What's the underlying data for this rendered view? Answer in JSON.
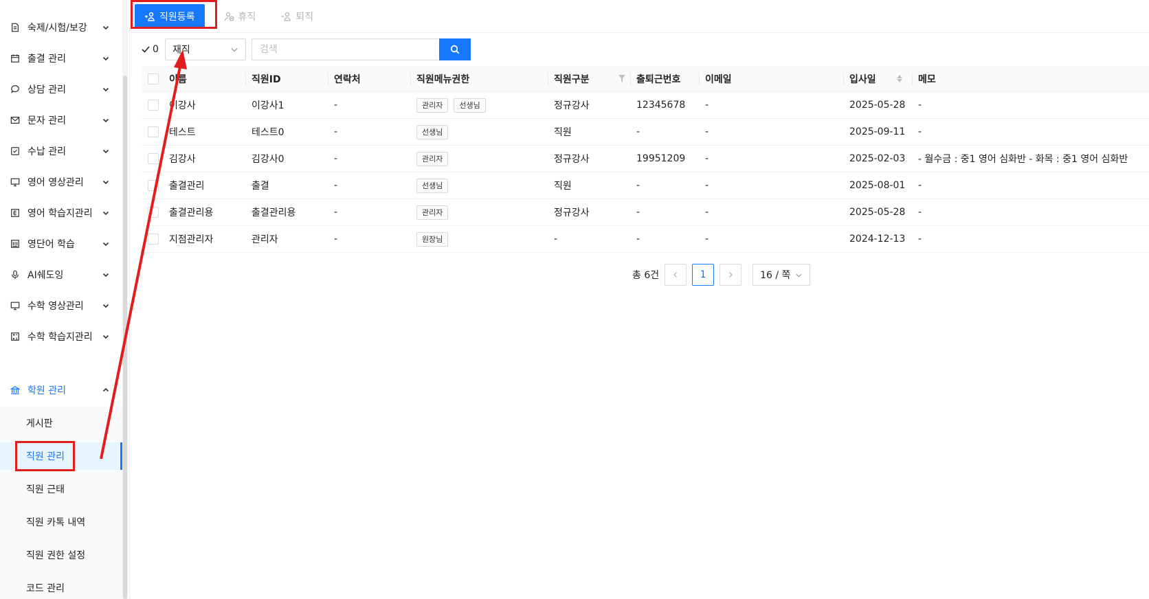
{
  "sidebar": {
    "items": [
      {
        "label": "숙제/시험/보강",
        "icon": "document-icon"
      },
      {
        "label": "출결 관리",
        "icon": "calendar-icon"
      },
      {
        "label": "상담 관리",
        "icon": "chat-icon"
      },
      {
        "label": "문자 관리",
        "icon": "mail-icon"
      },
      {
        "label": "수납 관리",
        "icon": "payment-icon"
      },
      {
        "label": "영어 영상관리",
        "icon": "monitor-icon"
      },
      {
        "label": "영어 학습지관리",
        "icon": "worksheet-icon"
      },
      {
        "label": "영단어 학습",
        "icon": "book-icon"
      },
      {
        "label": "AI쉐도잉",
        "icon": "microphone-icon"
      },
      {
        "label": "수학 영상관리",
        "icon": "monitor-icon"
      },
      {
        "label": "수학 학습지관리",
        "icon": "calculator-icon"
      },
      {
        "label": "학원 관리",
        "icon": "bank-icon"
      }
    ],
    "sub_items": [
      {
        "label": "게시판"
      },
      {
        "label": "직원 관리"
      },
      {
        "label": "직원 근태"
      },
      {
        "label": "직원 카톡 내역"
      },
      {
        "label": "직원 권한 설정"
      },
      {
        "label": "코드 관리"
      }
    ]
  },
  "toolbar": {
    "register_label": "직원등록",
    "leave_label": "휴직",
    "resign_label": "퇴직"
  },
  "filter": {
    "selected_count": "0",
    "status_value": "재직",
    "search_placeholder": "검색"
  },
  "table": {
    "headers": {
      "name": "이름",
      "staff_id": "직원ID",
      "contact": "연락처",
      "menu_permission": "직원메뉴권한",
      "staff_type": "직원구분",
      "attendance_no": "출퇴근번호",
      "email": "이메일",
      "join_date": "입사일",
      "memo": "메모"
    },
    "rows": [
      {
        "name": "이강사",
        "staff_id": "이강사1",
        "contact": "-",
        "tags": [
          "관리자",
          "선생님"
        ],
        "staff_type": "정규강사",
        "attendance_no": "12345678",
        "email": "-",
        "join_date": "2025-05-28",
        "memo": "-"
      },
      {
        "name": "테스트",
        "staff_id": "테스트0",
        "contact": "-",
        "tags": [
          "선생님"
        ],
        "staff_type": "직원",
        "attendance_no": "-",
        "email": "-",
        "join_date": "2025-09-11",
        "memo": "-"
      },
      {
        "name": "김강사",
        "staff_id": "김강사0",
        "contact": "-",
        "tags": [
          "관리자"
        ],
        "staff_type": "정규강사",
        "attendance_no": "19951209",
        "email": "-",
        "join_date": "2025-02-03",
        "memo": "- 월수금 : 중1 영어 심화반 - 화목 : 중1 영어 심화반"
      },
      {
        "name": "출결관리",
        "staff_id": "출결",
        "contact": "-",
        "tags": [
          "선생님"
        ],
        "staff_type": "직원",
        "attendance_no": "-",
        "email": "-",
        "join_date": "2025-08-01",
        "memo": "-"
      },
      {
        "name": "출결관리용",
        "staff_id": "출결관리용",
        "contact": "-",
        "tags": [
          "관리자"
        ],
        "staff_type": "정규강사",
        "attendance_no": "-",
        "email": "-",
        "join_date": "2025-05-28",
        "memo": "-"
      },
      {
        "name": "지점관리자",
        "staff_id": "관리자",
        "contact": "-",
        "tags": [
          "원장님"
        ],
        "staff_type": "-",
        "attendance_no": "-",
        "email": "-",
        "join_date": "2024-12-13",
        "memo": "-"
      }
    ]
  },
  "pagination": {
    "total_label": "총 6건",
    "current_page": "1",
    "page_size_label": "16 / 쪽"
  },
  "colors": {
    "primary": "#1677ff",
    "annotation_red": "#e11d1d"
  }
}
